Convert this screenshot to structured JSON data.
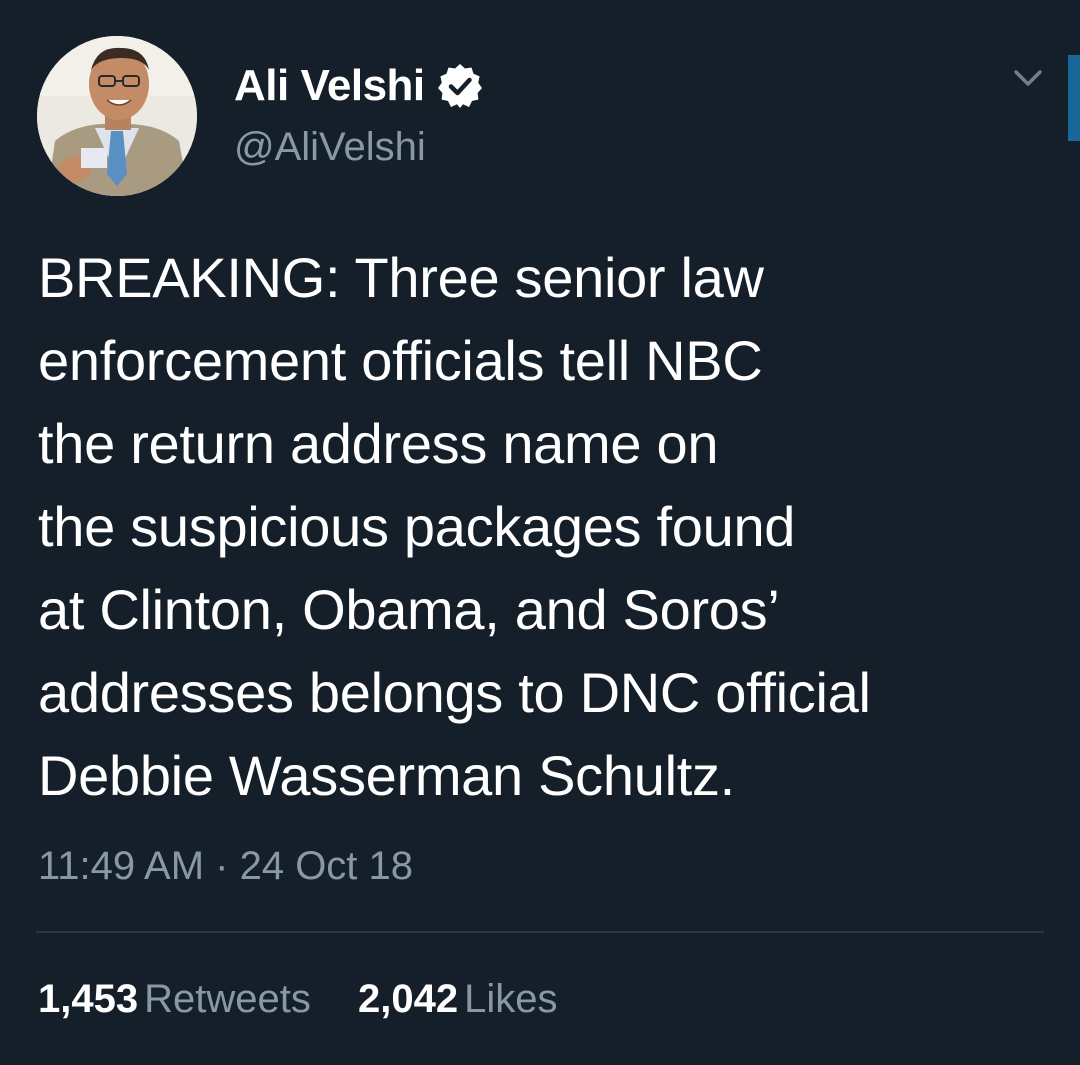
{
  "author": {
    "name": "Ali Velshi",
    "handle": "@AliVelshi",
    "verified": true,
    "avatar_icon": "profile-photo"
  },
  "tweet": {
    "text": "BREAKING: Three senior law\nenforcement officials tell NBC\nthe return address name on\nthe suspicious packages found\nat Clinton, Obama, and Soros’\naddresses belongs to DNC official\nDebbie Wasserman Schultz.",
    "timestamp": "11:49 AM · 24 Oct 18"
  },
  "stats": {
    "retweets_count": "1,453",
    "retweets_label": "Retweets",
    "likes_count": "2,042",
    "likes_label": "Likes"
  },
  "colors": {
    "background": "#151f2a",
    "primary_text": "#ffffff",
    "secondary_text": "#8899a6",
    "accent": "#1da1f2",
    "divider": "#2a3744"
  },
  "icons": {
    "verified": "verified-badge-icon",
    "menu": "chevron-down-icon"
  }
}
